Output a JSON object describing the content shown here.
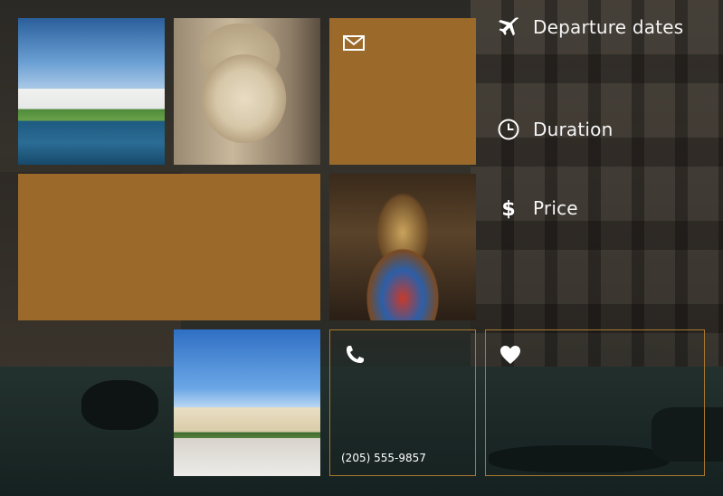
{
  "filters": {
    "departure_dates": {
      "label": "Departure dates",
      "icon": "airplane-icon"
    },
    "duration": {
      "label": "Duration",
      "icon": "clock-icon"
    },
    "price": {
      "label": "Price",
      "icon": "dollar-icon"
    }
  },
  "tiles": {
    "contact": {
      "phone": "(205) 555-9857",
      "icon": "phone-icon"
    },
    "mail": {
      "icon": "mail-icon"
    },
    "favorite": {
      "icon": "heart-icon"
    }
  },
  "colors": {
    "accent_gold": "#9b6a2a",
    "outline_gold": "#a8782f"
  }
}
